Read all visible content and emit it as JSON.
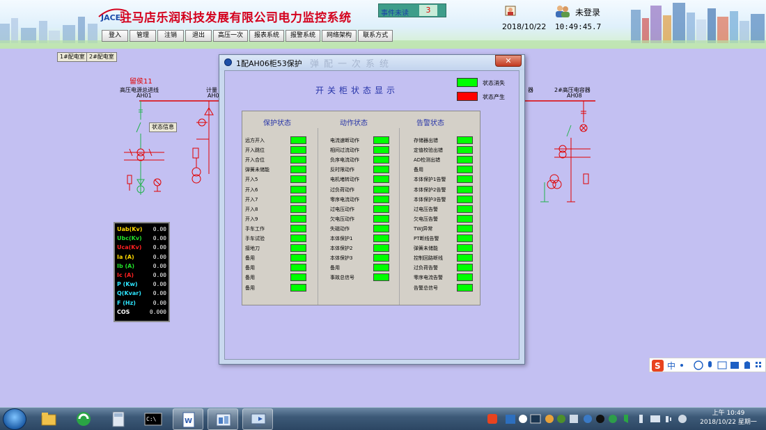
{
  "app": {
    "title": "驻马店乐润科技发展有限公司电力监控系统",
    "logo_text": "JACE",
    "alarm_label": "事件未读",
    "alarm_count": "3",
    "date": "2018/10/22",
    "time": "10:49:45.7",
    "login_status": "未登录"
  },
  "menu": [
    "登入",
    "管理",
    "注销",
    "退出",
    "高压一次",
    "报表系统",
    "报警系统",
    "网络架构",
    "联系方式"
  ],
  "substations": [
    "1#配电室",
    "2#配电室"
  ],
  "schematic": {
    "reserved_label": "留侯11",
    "feeder_left": {
      "name": "高压电源总进线",
      "code": "AH01"
    },
    "feeder_left2": {
      "name": "计量",
      "code": "AH0"
    },
    "feeder_right_partial": "器",
    "feeder_right": {
      "name": "2#高压电容器",
      "code": "AH08"
    },
    "status_info_button": "状态信息"
  },
  "meter": [
    {
      "label": "Uab(Kv)",
      "value": "0.00",
      "color": "#ffd800"
    },
    {
      "label": "Ubc(Kv)",
      "value": "0.00",
      "color": "#22e02a"
    },
    {
      "label": "Uca(Kv)",
      "value": "0.00",
      "color": "#ff2020"
    },
    {
      "label": "Ia  (A)",
      "value": "0.00",
      "color": "#ffd800"
    },
    {
      "label": "Ib  (A)",
      "value": "0.00",
      "color": "#22e02a"
    },
    {
      "label": "Ic  (A)",
      "value": "0.00",
      "color": "#ff2020"
    },
    {
      "label": "P  (Kw)",
      "value": "0.00",
      "color": "#2ee6ff"
    },
    {
      "label": "Q(Kvar)",
      "value": "0.00",
      "color": "#2ee6ff"
    },
    {
      "label": "F  (Hz)",
      "value": "0.00",
      "color": "#2ee6ff"
    },
    {
      "label": "COS",
      "value": "0.000",
      "color": "#ffffff"
    }
  ],
  "dialog": {
    "title": "1配AH06柜53保护",
    "watermark": "弹配一次系统",
    "close_label": "✕",
    "panel_title": "开关柜状态显示",
    "legend": [
      {
        "label": "状态消失",
        "color": "#00ff00"
      },
      {
        "label": "状态产生",
        "color": "#ff0000"
      }
    ],
    "columns": [
      {
        "title": "保护状态",
        "rows": [
          "远方开入",
          "开入跳位",
          "开入合位",
          "弹簧未储能",
          "开入5",
          "开入6",
          "开入7",
          "开入8",
          "开入9",
          "手车工作",
          "手车试验",
          "接地刀",
          "备用",
          "备用",
          "备用",
          "备用"
        ]
      },
      {
        "title": "动作状态",
        "rows": [
          "电流速断动作",
          "相间过流动作",
          "负序电流动作",
          "反时限动作",
          "电机堵转动作",
          "过负荷动作",
          "零序电流动作",
          "过电压动作",
          "欠电压动作",
          "失磁动作",
          "本体保护1",
          "本体保护2",
          "本体保护3",
          "备用",
          "事故总信号"
        ]
      },
      {
        "title": "告警状态",
        "rows": [
          "存储器出错",
          "定值校验出错",
          "AD检测出错",
          "备用",
          "本体保护1告警",
          "本体保护2告警",
          "本体保护3告警",
          "过电压告警",
          "欠电压告警",
          "TWJ异常",
          "PT断线告警",
          "弹簧未储能",
          "控制回路断线",
          "过负荷告警",
          "零序电流告警",
          "告警总信号"
        ]
      }
    ]
  },
  "taskbar": {
    "clock_time": "上午 10:49",
    "clock_date": "2018/10/22 星期一"
  },
  "ime": {
    "lang": "中"
  }
}
